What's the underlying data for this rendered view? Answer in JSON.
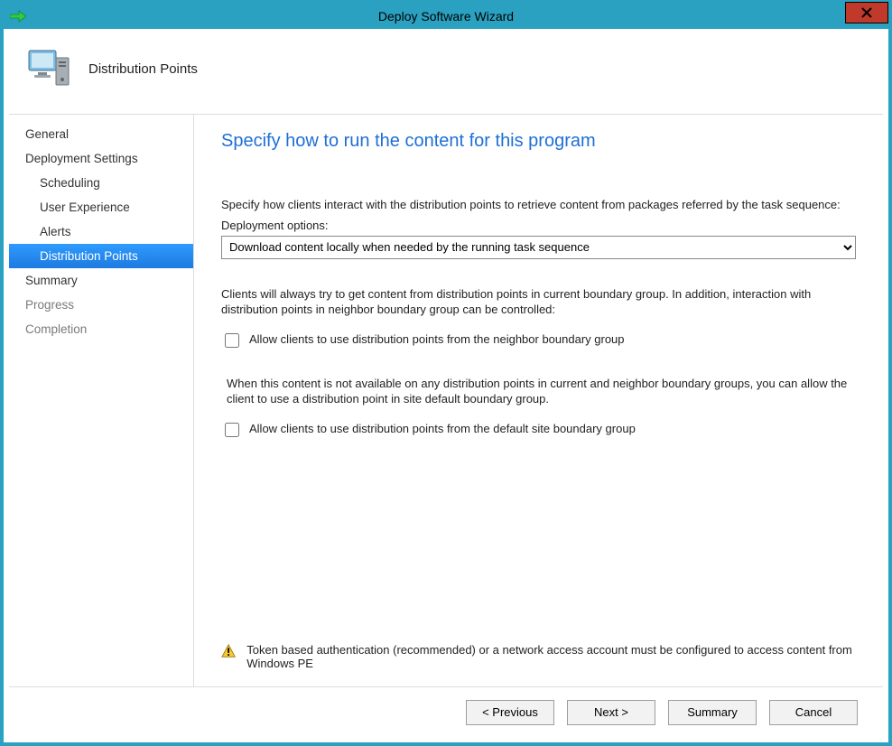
{
  "window": {
    "title": "Deploy Software Wizard"
  },
  "header": {
    "page_label": "Distribution Points"
  },
  "sidebar": {
    "items": [
      {
        "label": "General",
        "kind": "top"
      },
      {
        "label": "Deployment Settings",
        "kind": "top"
      },
      {
        "label": "Scheduling",
        "kind": "sub"
      },
      {
        "label": "User Experience",
        "kind": "sub"
      },
      {
        "label": "Alerts",
        "kind": "sub"
      },
      {
        "label": "Distribution Points",
        "kind": "sub",
        "active": true
      },
      {
        "label": "Summary",
        "kind": "top"
      },
      {
        "label": "Progress",
        "kind": "top",
        "muted": true
      },
      {
        "label": "Completion",
        "kind": "top",
        "muted": true
      }
    ]
  },
  "content": {
    "title": "Specify how to run the content for this program",
    "intro": "Specify how clients interact with the distribution points to retrieve content from packages referred by the task sequence:",
    "deploy_options_label": "Deployment options:",
    "deploy_options_value": "Download content locally when needed by the running task sequence",
    "boundary_para": "Clients will always try to get content from distribution points in current boundary group. In addition, interaction with distribution points in neighbor boundary group can be controlled:",
    "cb_neighbor": "Allow clients to use distribution points from the neighbor boundary group",
    "default_para": "When this content is not available on any distribution points in current and neighbor boundary groups, you can allow the client to use a distribution point in site default boundary group.",
    "cb_default": "Allow clients to use distribution points from the default site boundary group",
    "warning": "Token based authentication (recommended) or a network access account must be configured to access content from Windows PE"
  },
  "footer": {
    "previous": "< Previous",
    "next": "Next >",
    "summary": "Summary",
    "cancel": "Cancel"
  }
}
